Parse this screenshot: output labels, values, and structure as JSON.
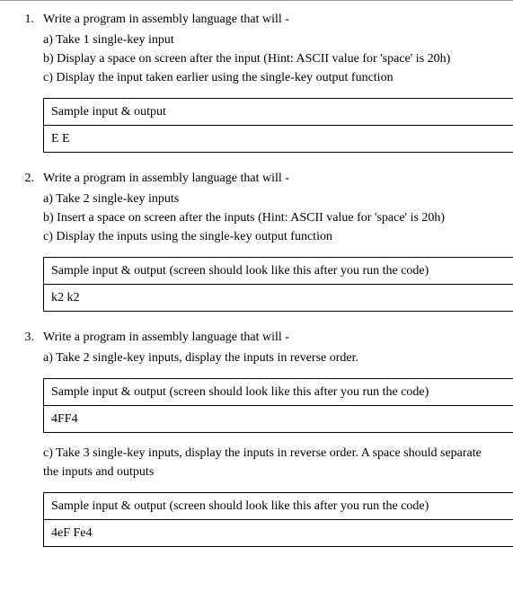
{
  "questions": [
    {
      "number": "1.",
      "intro": "Write a program in assembly language that will -",
      "items": [
        "a) Take 1 single-key input",
        "b) Display a space on screen after the input (Hint: ASCII value for 'space' is 20h)",
        "c) Display the input taken earlier using the single-key output function"
      ],
      "tables": [
        {
          "header": "Sample input & output",
          "value": "E E"
        }
      ]
    },
    {
      "number": "2.",
      "intro": "Write a program in assembly language that will -",
      "items": [
        "a) Take 2 single-key inputs",
        "b) Insert a space on screen after the inputs (Hint: ASCII value for 'space' is 20h)",
        "c) Display the inputs using the single-key output function"
      ],
      "tables": [
        {
          "header": "Sample input & output (screen should look like this after you run the code)",
          "value": "k2 k2"
        }
      ]
    },
    {
      "number": "3.",
      "intro": "Write a program in assembly language that will -",
      "items": [
        "a) Take 2 single-key inputs, display the inputs in reverse order."
      ],
      "tables": [
        {
          "header": "Sample input & output (screen should look like this after you run the code)",
          "value": "4FF4"
        }
      ],
      "followup": "c) Take 3 single-key inputs, display the inputs in reverse order. A space should separate the inputs and outputs",
      "tables2": [
        {
          "header": "Sample input & output (screen should look like this after you run the code)",
          "value": "4eF Fe4"
        }
      ]
    }
  ]
}
